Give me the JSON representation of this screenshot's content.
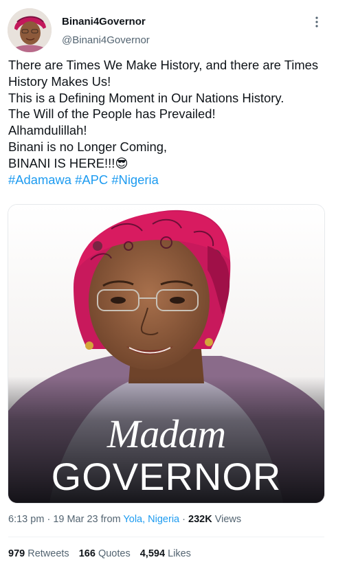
{
  "author": {
    "display_name": "Binani4Governor",
    "handle": "@Binani4Governor",
    "avatar_icon": "profile-photo"
  },
  "tweet": {
    "lines": [
      "There are Times We Make History, and there are Times",
      "History Makes Us!",
      "This is a Defining Moment in Our Nations History.",
      "The Will of the People has Prevailed!",
      "Alhamdulillah!",
      "Binani is no Longer Coming,",
      "BINANI IS HERE!!!😎"
    ],
    "hashtags": [
      "#Adamawa",
      "#APC",
      "#Nigeria"
    ]
  },
  "media": {
    "overlay_line1": "Madam",
    "overlay_line2": "GOVERNOR"
  },
  "meta": {
    "time": "6:13 pm",
    "separator": "·",
    "date": "19 Mar 23",
    "from_label": "from",
    "location": "Yola, Nigeria",
    "views_count": "232K",
    "views_label": "Views"
  },
  "stats": {
    "retweets_count": "979",
    "retweets_label": "Retweets",
    "quotes_count": "166",
    "quotes_label": "Quotes",
    "likes_count": "4,594",
    "likes_label": "Likes"
  },
  "colors": {
    "link": "#1d9bf0",
    "text_primary": "#0f1419",
    "text_secondary": "#536471"
  },
  "icons": {
    "more": "vertical-ellipsis-icon"
  }
}
